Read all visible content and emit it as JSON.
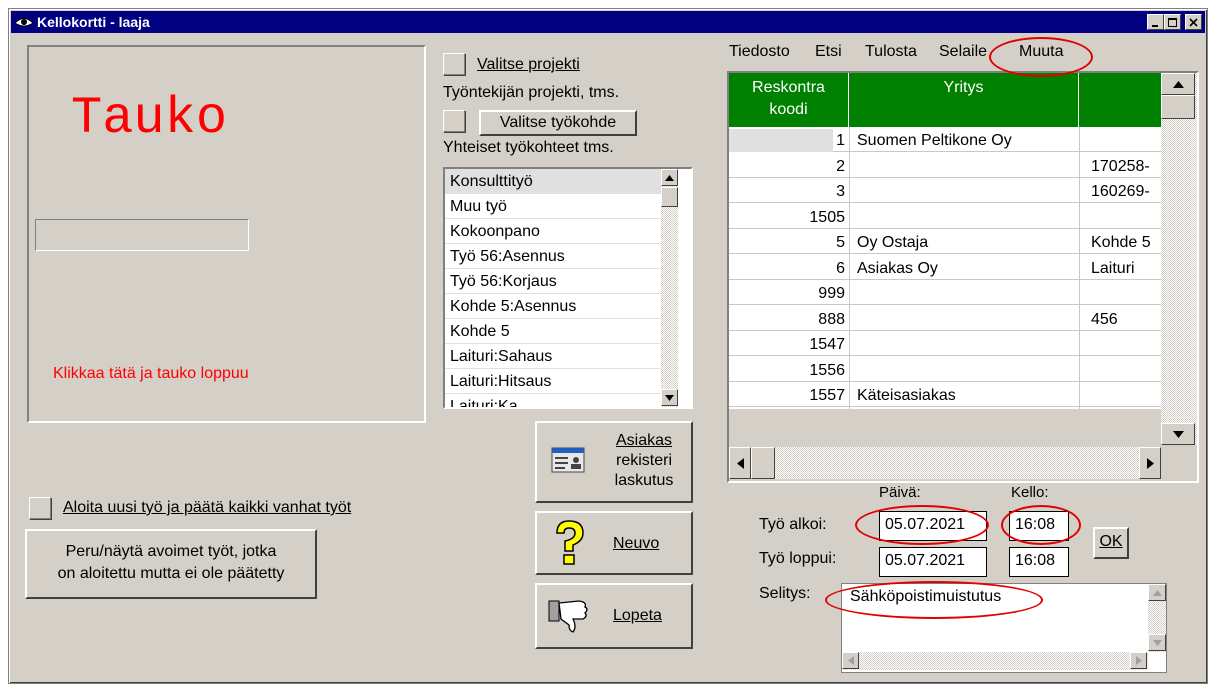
{
  "window": {
    "title": "Kellokortti - laaja"
  },
  "left_panel": {
    "status_title": "Tauko",
    "status_hint": "Klikkaa tätä ja tauko loppuu"
  },
  "project": {
    "select_label": "Valitse projekti",
    "employee_project_label": "Työntekijän projekti, tms.",
    "select_worktarget_button": "Valitse työkohde",
    "shared_targets_label": "Yhteiset työkohteet tms.",
    "items": [
      "Konsulttityö",
      "Muu työ",
      "Kokoonpano",
      "Työ 56:Asennus",
      "Työ 56:Korjaus",
      "Kohde 5:Asennus",
      "Kohde 5",
      "Laituri:Sahaus",
      "Laituri:Hitsaus",
      "Laituri:Ka"
    ]
  },
  "menu": [
    "Tiedosto",
    "Etsi",
    "Tulosta",
    "Selaile",
    "Muuta"
  ],
  "grid": {
    "headers": [
      "Reskontra koodi",
      "Yritys",
      ""
    ],
    "rows": [
      [
        "1",
        "Suomen Peltikone Oy",
        ""
      ],
      [
        "2",
        "",
        "170258-"
      ],
      [
        "3",
        "",
        "160269-"
      ],
      [
        "1505",
        "",
        ""
      ],
      [
        "5",
        "Oy Ostaja",
        "Kohde 5"
      ],
      [
        "6",
        "Asiakas Oy",
        "Laituri"
      ],
      [
        "999",
        "",
        ""
      ],
      [
        "888",
        "",
        "456"
      ],
      [
        "1547",
        "",
        ""
      ],
      [
        "1556",
        "",
        ""
      ],
      [
        "1557",
        "Käteisasiakas",
        ""
      ]
    ]
  },
  "buttons": {
    "customer_line1": "Asiakas",
    "customer_line2": "rekisteri",
    "customer_line3": "laskutus",
    "advice": "Neuvo",
    "quit": "Lopeta",
    "ok": "OK",
    "cancel_line1": "Peru/näytä avoimet työt, jotka",
    "cancel_line2": "on aloitettu mutta ei ole päätetty"
  },
  "new_work_label": "Aloita uusi työ ja päätä kaikki vanhat työt",
  "time": {
    "date_header": "Päivä:",
    "time_header": "Kello:",
    "started_label": "Työ alkoi:",
    "ended_label": "Työ loppui:",
    "start_date": "05.07.2021",
    "start_time": "16:08",
    "end_date": "05.07.2021",
    "end_time": "16:08",
    "description_label": "Selitys:",
    "description": "Sähköpoistimuistutus"
  },
  "colors": {
    "titlebar": "#000080",
    "grid_header": "#008000",
    "status_red": "#ff0000",
    "annotation_red": "#e00000"
  }
}
